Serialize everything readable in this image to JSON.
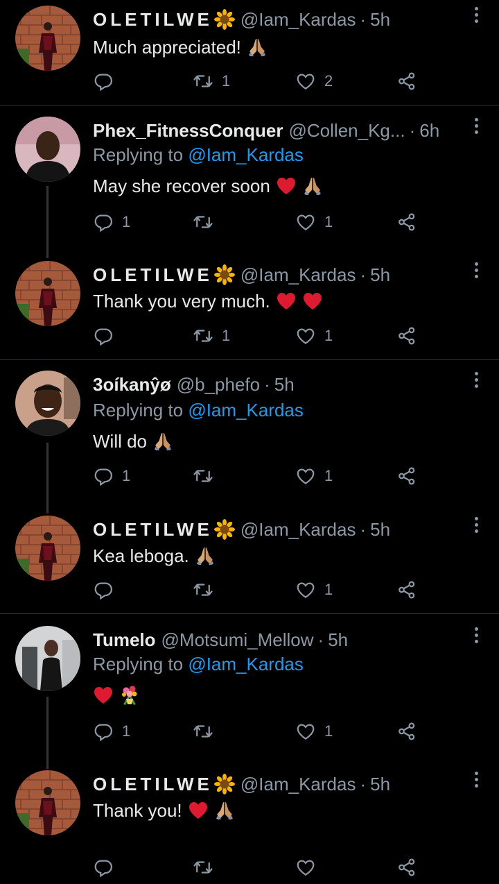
{
  "tweets": [
    {
      "name": "OLETILWE",
      "name_has_sunflower": true,
      "handle": "@Iam_Kardas",
      "time": "5h",
      "replying_to": null,
      "text": "Much appreciated!",
      "emojis": [
        "folded-hands"
      ],
      "replies": "",
      "retweets": "1",
      "likes": "2",
      "avatar": "oletilwe",
      "thread_line": false
    },
    {
      "name": "Phex_FitnessConquer",
      "name_has_sunflower": false,
      "handle": "@Collen_Kg...",
      "time": "6h",
      "replying_to": {
        "prefix": "Replying to",
        "mention": "@Iam_Kardas"
      },
      "text": "May she recover soon",
      "emojis": [
        "red-heart",
        "folded-hands"
      ],
      "replies": "1",
      "retweets": "",
      "likes": "1",
      "avatar": "phex",
      "thread_line": true
    },
    {
      "name": "OLETILWE",
      "name_has_sunflower": true,
      "handle": "@Iam_Kardas",
      "time": "5h",
      "replying_to": null,
      "text": "Thank you very much.",
      "emojis": [
        "red-heart",
        "red-heart"
      ],
      "replies": "",
      "retweets": "1",
      "likes": "1",
      "avatar": "oletilwe",
      "thread_line": false
    },
    {
      "name": "3oíkanŷø",
      "name_has_sunflower": false,
      "handle": "@b_phefo",
      "time": "5h",
      "replying_to": {
        "prefix": "Replying to",
        "mention": "@Iam_Kardas"
      },
      "text": "Will do",
      "emojis": [
        "folded-hands"
      ],
      "replies": "1",
      "retweets": "",
      "likes": "1",
      "avatar": "boikanyo",
      "thread_line": true
    },
    {
      "name": "OLETILWE",
      "name_has_sunflower": true,
      "handle": "@Iam_Kardas",
      "time": "5h",
      "replying_to": null,
      "text": "Kea leboga.",
      "emojis": [
        "folded-hands"
      ],
      "replies": "",
      "retweets": "",
      "likes": "1",
      "avatar": "oletilwe",
      "thread_line": false
    },
    {
      "name": "Tumelo",
      "name_has_sunflower": false,
      "handle": "@Motsumi_Mellow",
      "time": "5h",
      "replying_to": {
        "prefix": "Replying to",
        "mention": "@Iam_Kardas"
      },
      "text": "",
      "emojis": [
        "red-heart",
        "bouquet"
      ],
      "replies": "1",
      "retweets": "",
      "likes": "1",
      "avatar": "tumelo",
      "thread_line": true
    },
    {
      "name": "OLETILWE",
      "name_has_sunflower": true,
      "handle": "@Iam_Kardas",
      "time": "5h",
      "replying_to": null,
      "text": "Thank you!",
      "emojis": [
        "red-heart",
        "folded-hands"
      ],
      "replies": "",
      "retweets": "",
      "likes": "",
      "avatar": "oletilwe",
      "thread_line": false
    }
  ],
  "colors": {
    "background": "#000000",
    "text": "#e7e9ea",
    "secondary": "#8b98a5",
    "link": "#1d9bf0",
    "divider": "#2f3336"
  }
}
